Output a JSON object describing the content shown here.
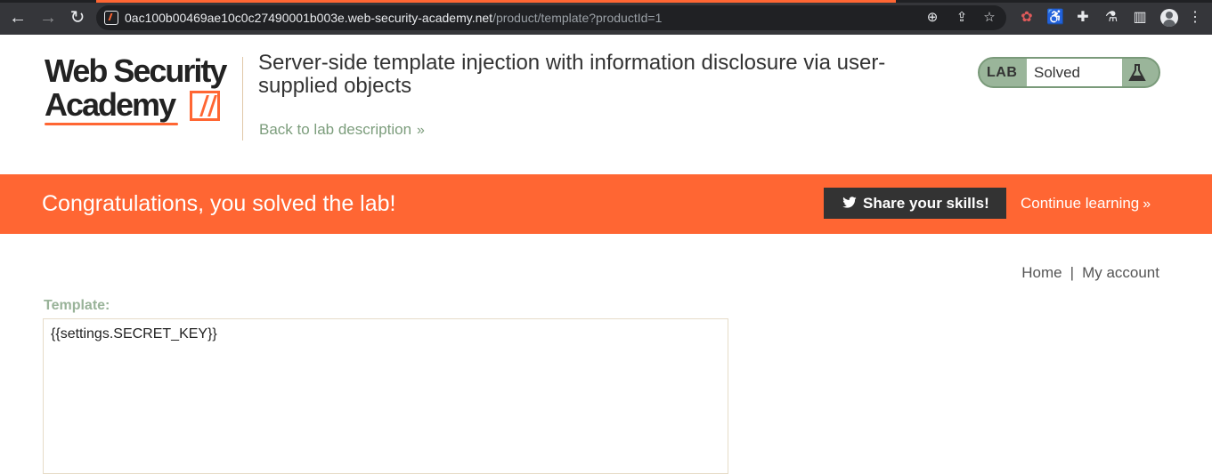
{
  "browser": {
    "url_host": "0ac100b00469ae10c0c27490001b003e.web-security-academy.net",
    "url_path": "/product/template?productId=1"
  },
  "header": {
    "logo_line1": "Web Security",
    "logo_line2": "Academy",
    "lab_title": "Server-side template injection with information disclosure via user-supplied objects",
    "back_link": "Back to lab description",
    "lab_badge": "LAB",
    "lab_status": "Solved"
  },
  "banner": {
    "message": "Congratulations, you solved the lab!",
    "share_label": "Share your skills!",
    "continue_label": "Continue learning"
  },
  "nav": {
    "home": "Home",
    "separator": "|",
    "account": "My account"
  },
  "form": {
    "template_label": "Template:",
    "template_value": "{{settings.SECRET_KEY}}"
  },
  "colors": {
    "brand_orange": "#ff6633",
    "solved_green": "#9ab59a",
    "share_button": "#333333"
  }
}
